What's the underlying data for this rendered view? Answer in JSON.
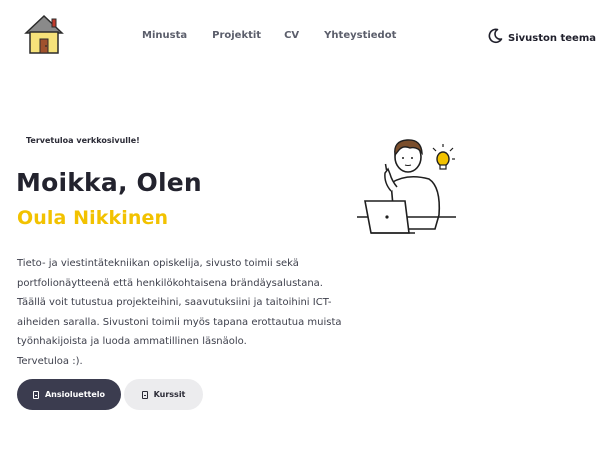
{
  "header": {
    "logo_icon": "house-icon",
    "nav": [
      {
        "label": "Minusta"
      },
      {
        "label": "Projektit"
      },
      {
        "label": "CV"
      },
      {
        "label": "Yhteystiedot"
      }
    ],
    "theme_icon": "moon-icon",
    "theme_label": "Sivuston teema"
  },
  "hero": {
    "welcome": "Tervetuloa verkkosivulle!",
    "title": "Moikka, Olen",
    "name": "Oula Nikkinen",
    "description_lines": [
      "Tieto- ja viestintätekniikan opiskelija, sivusto toimii sekä",
      "portfolionäytteenä että henkilökohtaisena brändäysalustana.",
      "Täällä voit tutustua projekteihini, saavutuksiini ja taitoihini ICT-",
      "aiheiden saralla. Sivustoni toimii myös tapana erottautua muista",
      "työnhakijoista ja luoda ammatillinen läsnäolo.",
      "Tervetuloa :)."
    ],
    "buttons": {
      "cv": "Ansioluettelo",
      "courses": "Kurssit"
    },
    "illustration_icon": "person-laptop-lightbulb-icon"
  },
  "colors": {
    "accent_yellow": "#f2c200",
    "primary_dark": "#3b3c4f",
    "secondary_light": "#ececee"
  }
}
